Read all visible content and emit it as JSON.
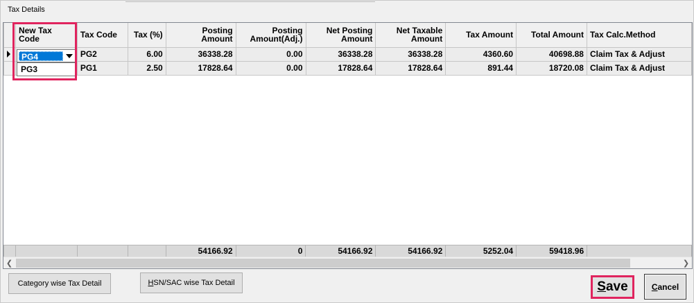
{
  "window": {
    "title": "Tax Details"
  },
  "grid": {
    "columns": [
      {
        "key": "new_tax_code",
        "label": "New Tax Code"
      },
      {
        "key": "tax_code",
        "label": "Tax Code"
      },
      {
        "key": "tax_pct",
        "label": "Tax (%)"
      },
      {
        "key": "posting_amount",
        "label": "Posting Amount"
      },
      {
        "key": "posting_amount_adj",
        "label": "Posting Amount(Adj.)"
      },
      {
        "key": "net_posting_amount",
        "label": "Net Posting Amount"
      },
      {
        "key": "net_taxable_amount",
        "label": "Net Taxable Amount"
      },
      {
        "key": "tax_amount",
        "label": "Tax Amount"
      },
      {
        "key": "total_amount",
        "label": "Total Amount"
      },
      {
        "key": "tax_calc_method",
        "label": "Tax Calc.Method"
      }
    ],
    "rows": [
      {
        "new_tax_code": "PG4",
        "tax_code": "PG2",
        "tax_pct": "6.00",
        "posting_amount": "36338.28",
        "posting_amount_adj": "0.00",
        "net_posting_amount": "36338.28",
        "net_taxable_amount": "36338.28",
        "tax_amount": "4360.60",
        "total_amount": "40698.88",
        "tax_calc_method": "Claim Tax & Adjust"
      },
      {
        "new_tax_code": "",
        "tax_code": "PG1",
        "tax_pct": "2.50",
        "posting_amount": "17828.64",
        "posting_amount_adj": "0.00",
        "net_posting_amount": "17828.64",
        "net_taxable_amount": "17828.64",
        "tax_amount": "891.44",
        "total_amount": "18720.08",
        "tax_calc_method": "Claim Tax & Adjust"
      }
    ],
    "combo": {
      "selected": "PG4",
      "options": [
        "PG3"
      ]
    },
    "totals": {
      "posting_amount": "54166.92",
      "posting_amount_adj": "0",
      "net_posting_amount": "54166.92",
      "net_taxable_amount": "54166.92",
      "tax_amount": "5252.04",
      "total_amount": "59418.96"
    }
  },
  "buttons": {
    "category_wise": "Category wise Tax Detail",
    "hsn_sac_prefix": "H",
    "hsn_sac_rest": "SN/SAC wise Tax Detail",
    "save_prefix": "S",
    "save_rest": "ave",
    "cancel_prefix": "C",
    "cancel_rest": "ancel"
  },
  "colors": {
    "highlight": "#e0245e",
    "selection": "#0078d7"
  }
}
